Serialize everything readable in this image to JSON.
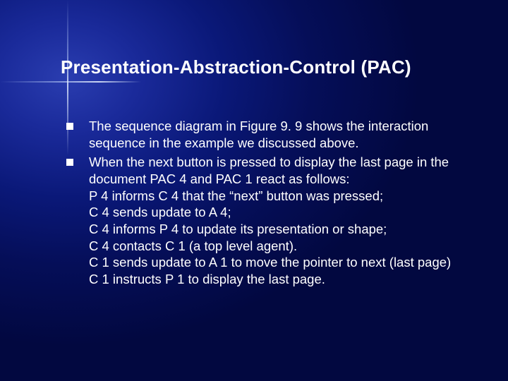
{
  "title": "Presentation-Abstraction-Control (PAC)",
  "bullets": [
    {
      "text": "The sequence diagram in Figure 9. 9 shows the interaction sequence in the example we discussed above."
    },
    {
      "text": "When the next button is pressed to display the last page in the document PAC 4 and PAC 1 react as follows:",
      "sublines": [
        "P 4 informs C 4 that the “next” button was pressed;",
        "C 4 sends update to A 4;",
        "C 4 informs P 4 to update its presentation or shape;",
        "C 4 contacts C 1 (a top level agent).",
        "C 1 sends update to A 1 to move the pointer to next (last page)",
        "C 1 instructs P 1 to display the last page."
      ]
    }
  ]
}
